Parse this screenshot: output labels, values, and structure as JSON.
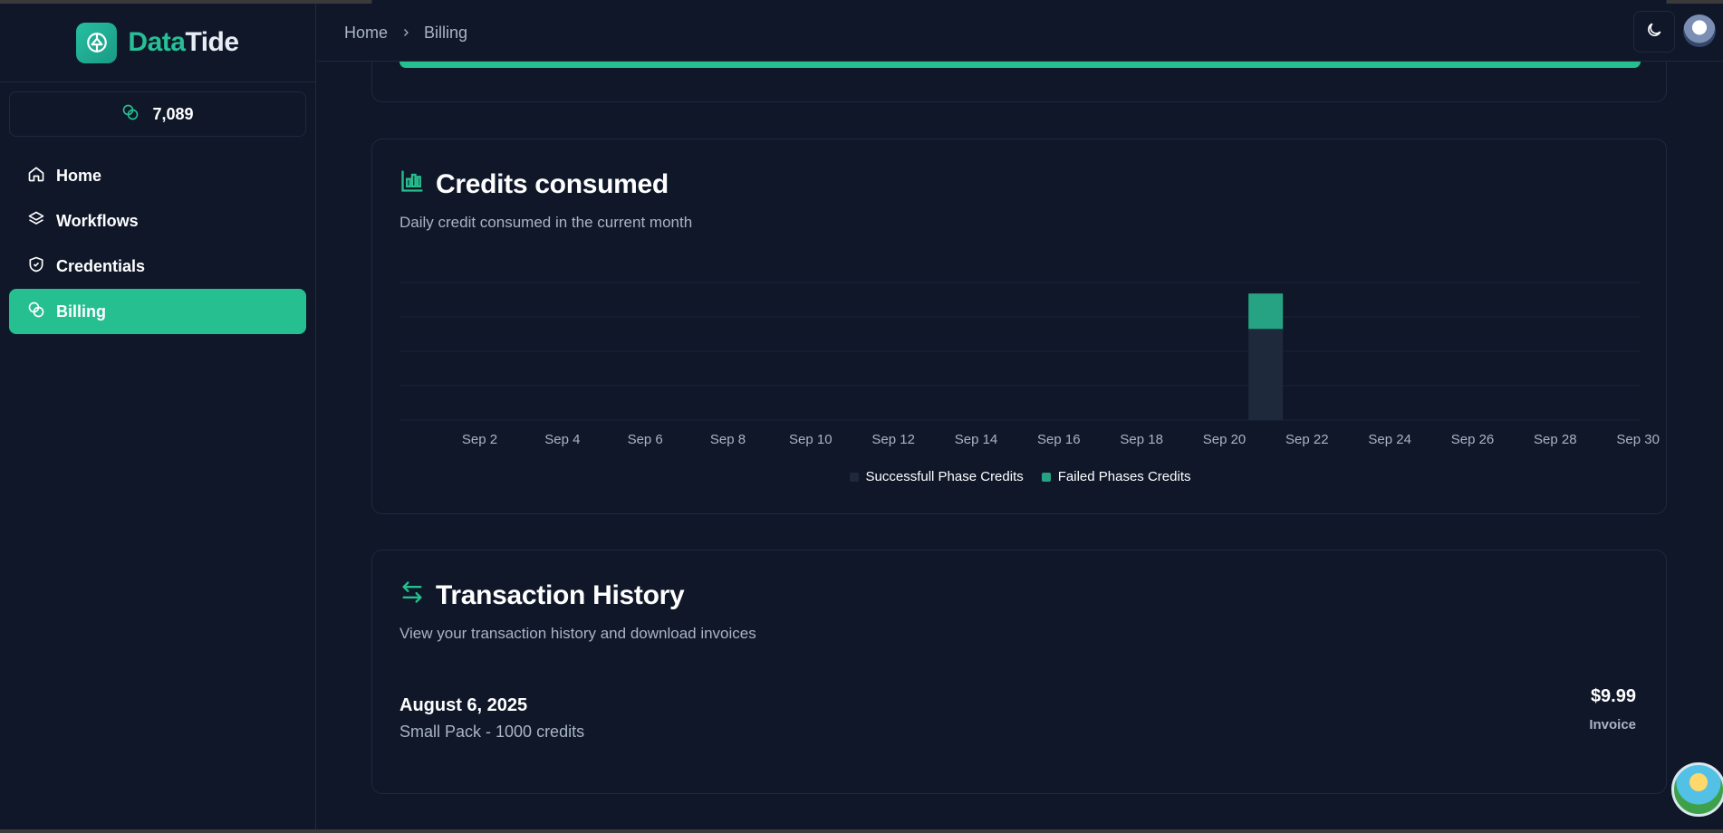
{
  "brand": {
    "part1": "Data",
    "part2": "Tide"
  },
  "sidebar": {
    "credits": "7,089",
    "items": [
      {
        "label": "Home",
        "icon": "home-icon"
      },
      {
        "label": "Workflows",
        "icon": "layers-icon"
      },
      {
        "label": "Credentials",
        "icon": "shield-icon"
      },
      {
        "label": "Billing",
        "icon": "coins-icon",
        "active": true
      }
    ]
  },
  "header": {
    "breadcrumb": [
      "Home",
      "Billing"
    ]
  },
  "credits_card": {
    "title": "Credits consumed",
    "subtitle": "Daily credit consumed in the current month"
  },
  "chart_data": {
    "type": "bar",
    "stacked": true,
    "categories": [
      "Sep 2",
      "Sep 4",
      "Sep 6",
      "Sep 8",
      "Sep 10",
      "Sep 12",
      "Sep 14",
      "Sep 16",
      "Sep 18",
      "Sep 20",
      "Sep 22",
      "Sep 24",
      "Sep 26",
      "Sep 28",
      "Sep 30"
    ],
    "bar_date": "Sep 21",
    "series": [
      {
        "name": "Successfull Phase Credits",
        "color": "#1e2a3b",
        "value": 72
      },
      {
        "name": "Failed Phases Credits",
        "color": "#26a383",
        "value": 28
      }
    ],
    "ylim": [
      0,
      100
    ],
    "grid": true,
    "legend": "bottom-center"
  },
  "transactions_card": {
    "title": "Transaction History",
    "subtitle": "View your transaction history and download invoices",
    "rows": [
      {
        "date": "August 6, 2025",
        "description": "Small Pack - 1000 credits",
        "amount": "$9.99",
        "action": "Invoice"
      }
    ]
  },
  "colors": {
    "accent": "#26bf8f",
    "background": "#0f1729",
    "border": "#1f2a3c"
  }
}
